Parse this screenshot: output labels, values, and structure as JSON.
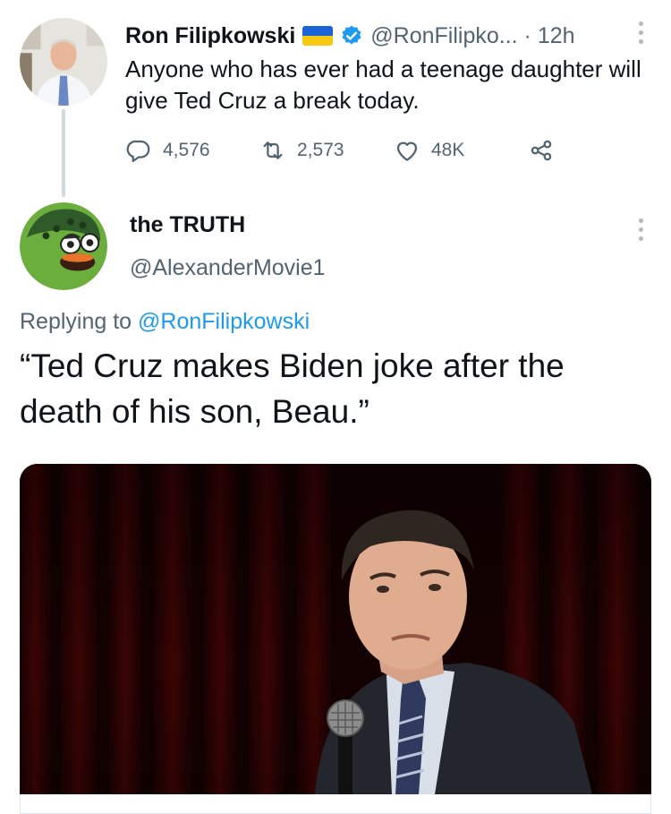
{
  "tweet1": {
    "author_name": "Ron Filipkowski",
    "handle_time": "@RonFilipko... · 12h",
    "text": "Anyone who has ever had a teenage daughter will give Ted Cruz a break today.",
    "reply_count": "4,576",
    "retweet_count": "2,573",
    "like_count": "48K",
    "icons": [
      "reply-icon",
      "retweet-icon",
      "like-icon",
      "share-icon",
      "ukraine-flag-icon",
      "verified-badge-icon",
      "more-options-icon"
    ]
  },
  "tweet2": {
    "author_name": "the TRUTH",
    "handle": "@AlexanderMovie1",
    "replying_prefix": "Replying to ",
    "replying_to": "@RonFilipkowski",
    "text": "“Ted Cruz makes Biden joke after the death of his son, Beau.”"
  },
  "colors": {
    "link": "#1d9bf0",
    "secondary_text": "#536471",
    "primary_text": "#0f1419",
    "thread_line": "#cfd9de"
  }
}
